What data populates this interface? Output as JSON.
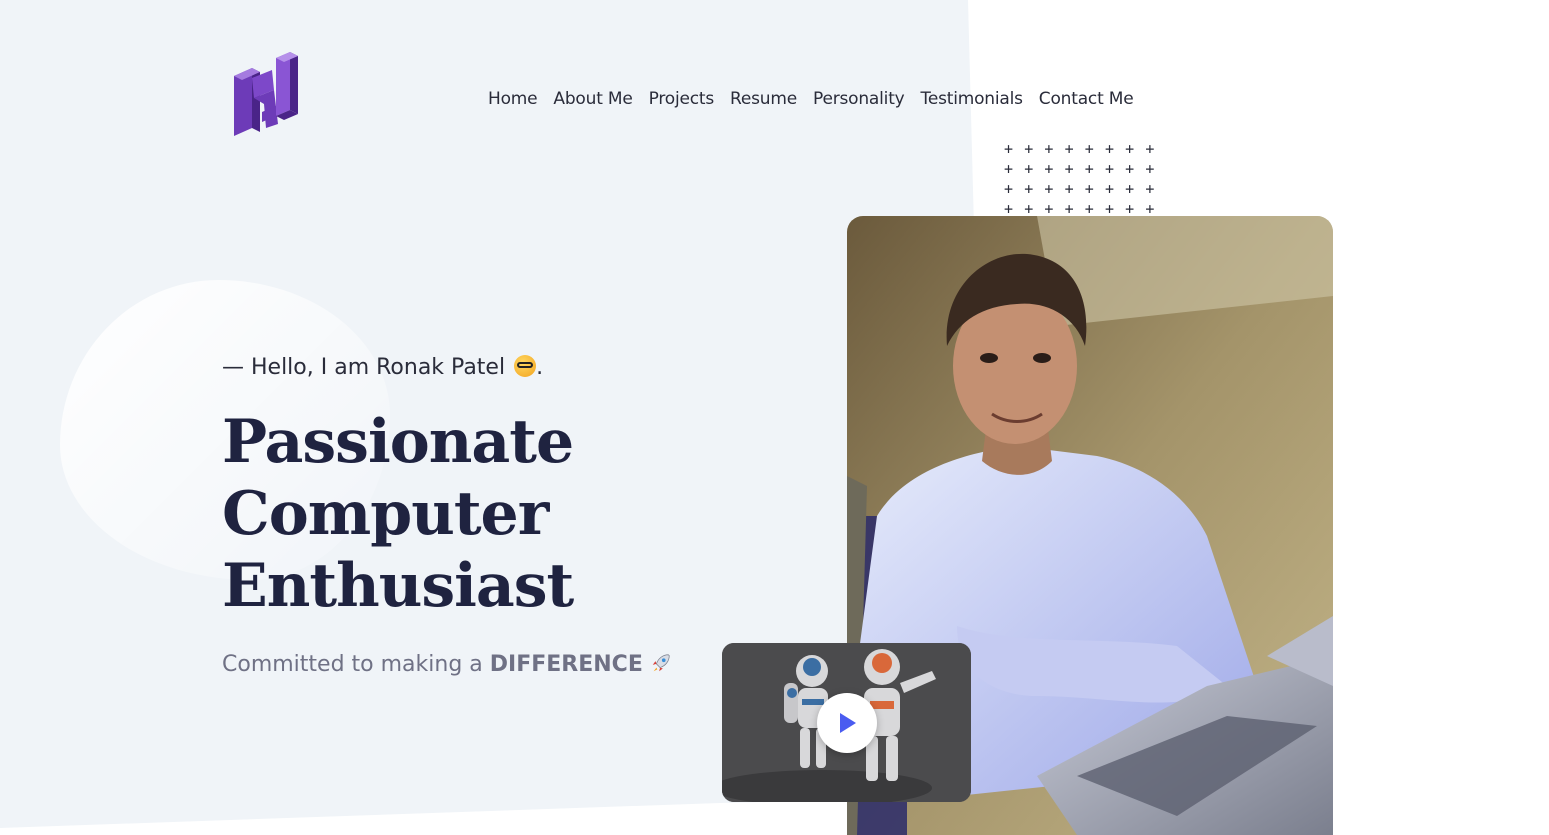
{
  "brand": {
    "logo_icon": "rj-logo-icon",
    "accent": "#7b3fc4"
  },
  "nav": {
    "items": [
      "Home",
      "About Me",
      "Projects",
      "Resume",
      "Personality",
      "Testimonials",
      "Contact Me"
    ]
  },
  "hero": {
    "greeting": "— Hello, I am Ronak Patel",
    "greeting_emoji": "nerd-face-icon",
    "greeting_end": ".",
    "headline_lines": [
      "Passionate",
      "Computer",
      "Enthusiast"
    ],
    "tagline_prefix": "Committed to making a ",
    "tagline_emphasis": "DIFFERENCE",
    "tagline_emoji": "rocket-icon"
  },
  "media": {
    "portrait": "portrait-photo",
    "video_thumbnail": "robots-video-thumbnail",
    "play_icon": "play-icon",
    "play_color": "#4a5cf0"
  },
  "decor": {
    "plus_grid_symbol": "+"
  },
  "colors": {
    "page_bg": "#f0f4f8",
    "heading": "#1f2340",
    "muted_text": "#6f7185"
  }
}
